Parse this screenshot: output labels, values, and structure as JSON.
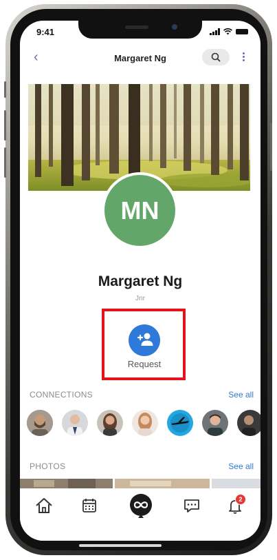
{
  "status_bar": {
    "time": "9:41"
  },
  "header": {
    "title": "Margaret Ng",
    "back_icon": "chevron-left-icon",
    "search_icon": "search-icon",
    "menu_icon": "kebab-menu-icon"
  },
  "profile": {
    "initials": "MN",
    "name": "Margaret Ng",
    "role": "Jnr",
    "avatar_color": "#62a769"
  },
  "action": {
    "label": "Request",
    "icon": "add-person-icon",
    "color": "#2f7ad9"
  },
  "connections": {
    "label": "CONNECTIONS",
    "see_all": "See all"
  },
  "photos": {
    "label": "PHOTOS",
    "see_all": "See all"
  },
  "tabbar": {
    "items": [
      "home-icon",
      "calendar-icon",
      "infinity-logo-icon",
      "chat-icon",
      "bell-icon"
    ],
    "notification_count": "2"
  },
  "colors": {
    "accent_purple": "#8060b8",
    "accent_blue": "#2f7ad9",
    "highlight_red": "#e3131b",
    "badge_red": "#e53935"
  }
}
